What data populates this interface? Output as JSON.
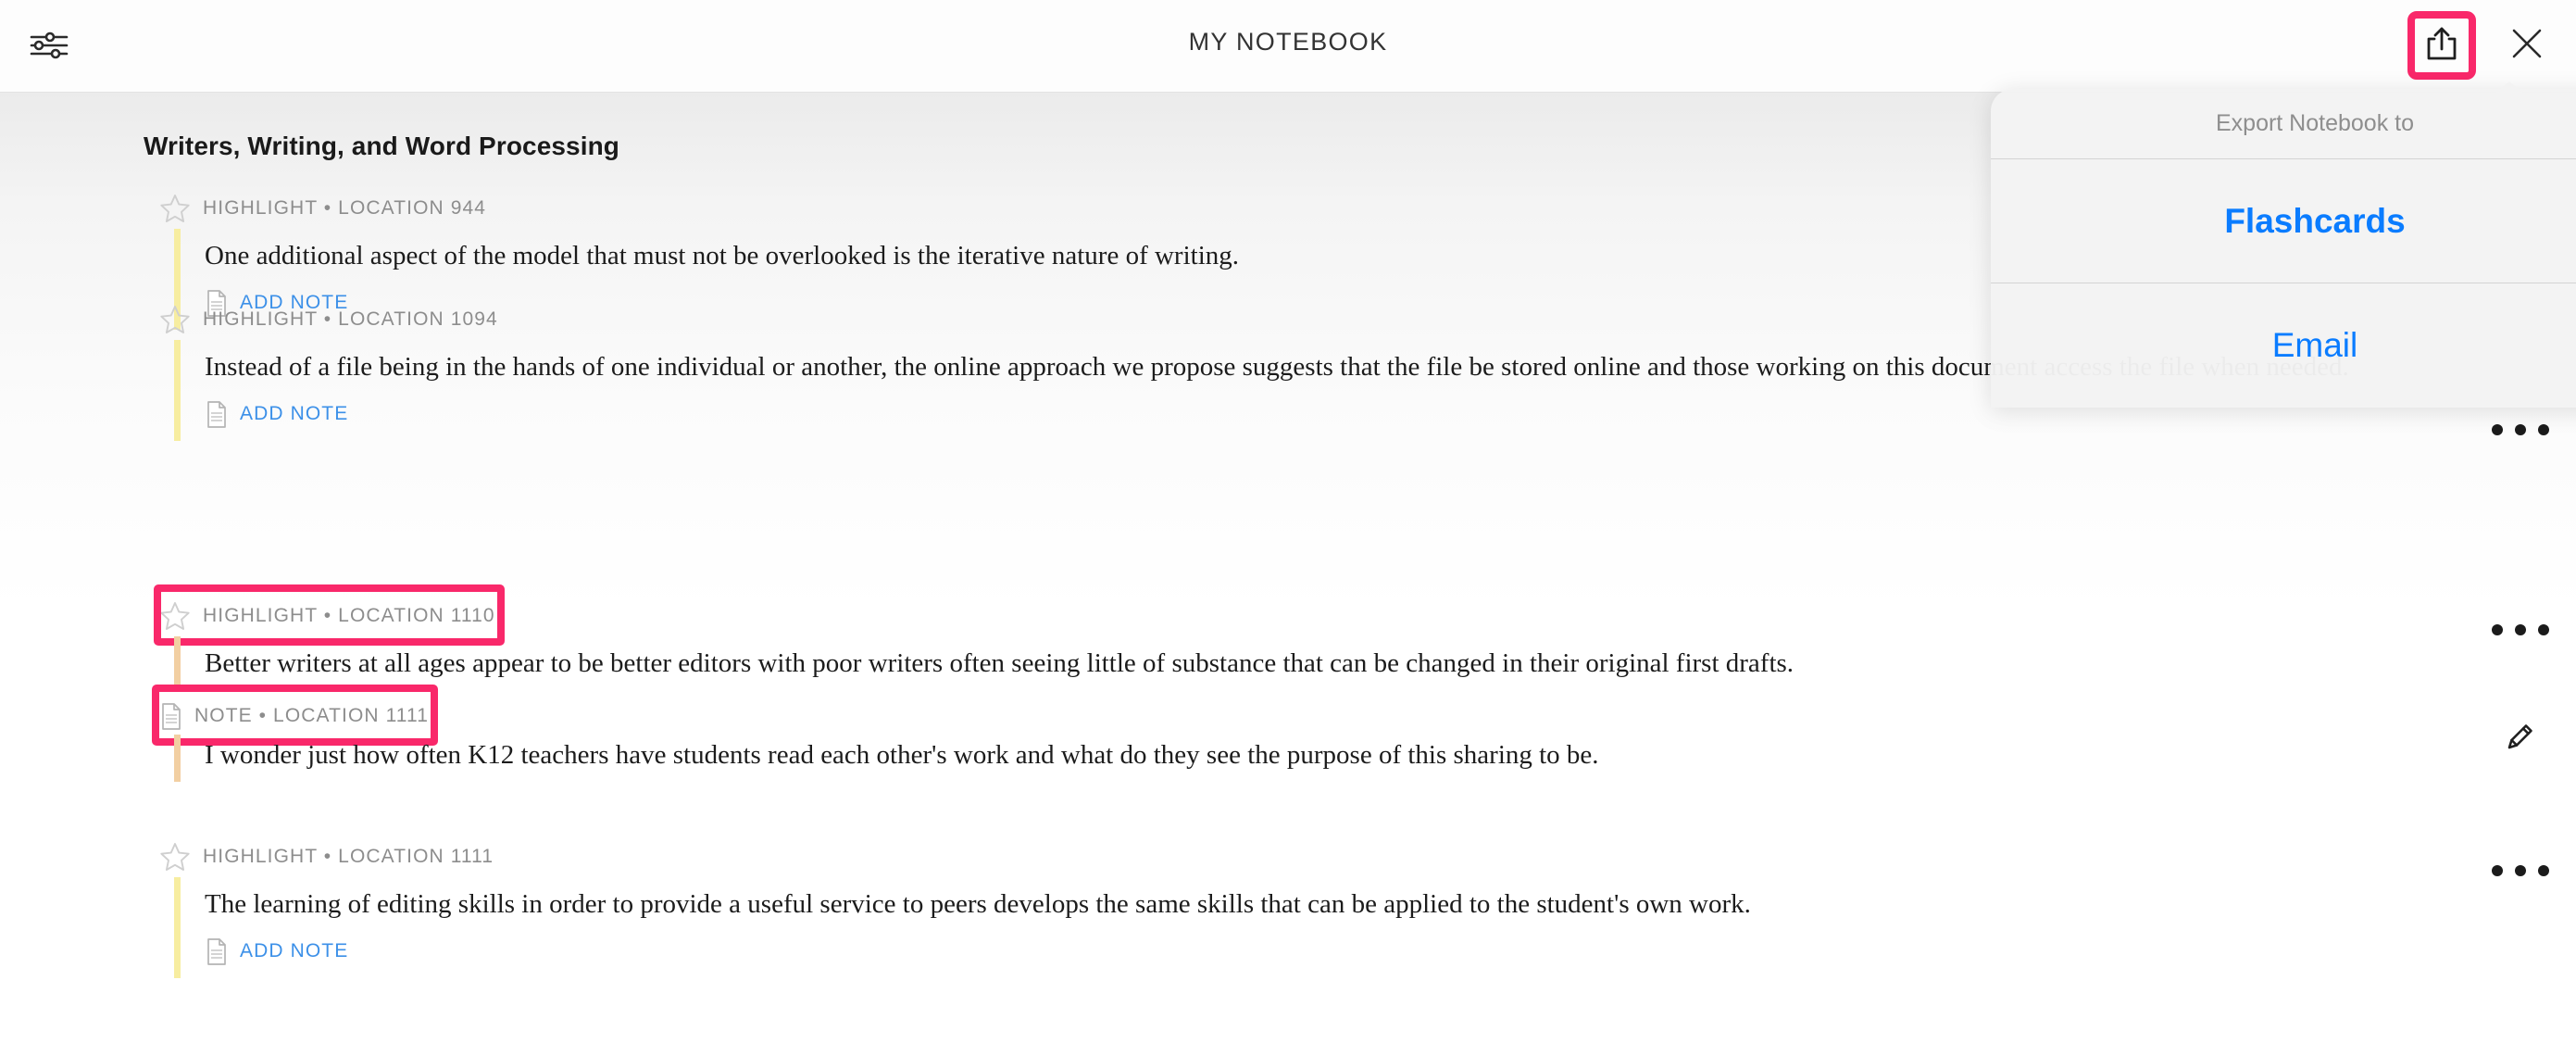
{
  "header": {
    "title": "MY NOTEBOOK",
    "filter_icon": "sliders-icon",
    "share_icon": "share-icon",
    "close_icon": "close-icon",
    "accent_annotation_color": "#f9286a"
  },
  "export_popover": {
    "heading": "Export Notebook to",
    "items": [
      {
        "label": "Flashcards",
        "bold": true
      },
      {
        "label": "Email",
        "bold": false
      }
    ],
    "link_color": "#0a7cff"
  },
  "notebook": {
    "section_title": "Writers, Writing, and Word Processing",
    "add_note_label": "ADD NOTE",
    "entries": [
      {
        "meta": "HIGHLIGHT • LOCATION 944",
        "text": "One additional aspect of the model that must not be overlooked is the iterative nature of writing.",
        "highlight_color": "#f7eda0",
        "annotated": false,
        "has_add_note": true,
        "row_action": "none"
      },
      {
        "meta": "HIGHLIGHT • LOCATION 1094",
        "text": "Instead of a file being in the hands of one individual or another, the online approach we propose suggests that the file be stored online and those working on this document access the file when needed.",
        "highlight_color": "#f7eda0",
        "annotated": false,
        "has_add_note": true,
        "row_action": "ellipsis"
      },
      {
        "meta": "HIGHLIGHT • LOCATION 1110",
        "text": "Better writers at all ages appear to be better editors with poor writers often seeing little of substance that can be changed in their original first drafts.",
        "highlight_color": "#f2cfa2",
        "annotated": true,
        "has_add_note": false,
        "row_action": "ellipsis",
        "note": {
          "meta": "NOTE • LOCATION 1111",
          "text": "I wonder just how often K12 teachers have students read each other's work and what do they see the purpose of this sharing to be.",
          "annotated": true,
          "row_action": "pencil"
        }
      },
      {
        "meta": "HIGHLIGHT • LOCATION 1111",
        "text": "The learning of editing skills in order to provide a useful service to peers develops the same skills that can be applied to the student's own work.",
        "highlight_color": "#f7eda0",
        "annotated": false,
        "has_add_note": true,
        "row_action": "ellipsis"
      }
    ]
  }
}
